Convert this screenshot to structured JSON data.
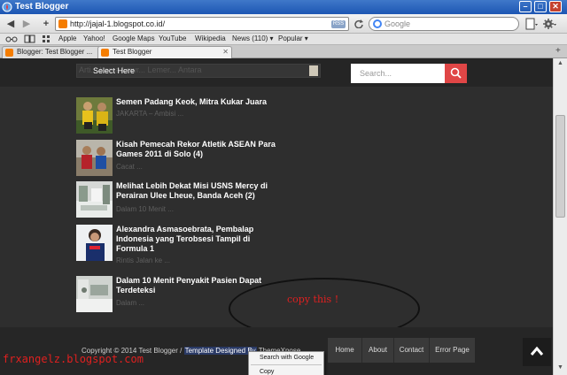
{
  "window": {
    "title": "Test Blogger",
    "minimize_glyph": "–",
    "maximize_glyph": "□",
    "close_glyph": "✕"
  },
  "toolbar": {
    "back_glyph": "◀",
    "forward_glyph": "▶",
    "add_glyph": "+",
    "url": "http://jajal-1.blogspot.co.id/",
    "rss_label": "RSS",
    "search_placeholder": "Google"
  },
  "bookmarks": {
    "reader_icon": "glasses-icon",
    "book_icon": "book-icon",
    "grid_icon": "grid-icon",
    "items": [
      "Apple",
      "Yahoo!",
      "Google Maps",
      "YouTube",
      "Wikipedia",
      "News (110) ▾",
      "Popular ▾"
    ]
  },
  "tabs": [
    {
      "label": "Blogger: Test Blogger ...",
      "close": "✕"
    },
    {
      "label": "Test Blogger",
      "close": "✕"
    }
  ],
  "page": {
    "select": {
      "ghost_text": "Arti... Lama   Lowr...   Lemer...   Antara",
      "label": "Select Here"
    },
    "search_placeholder": "Search...",
    "posts": [
      {
        "title": "Semen Padang Keok, Mitra Kukar Juara",
        "snippet": "JAKARTA – Ambisi ..."
      },
      {
        "title": "Kisah Pemecah Rekor Atletik ASEAN Para Games 2011 di Solo (4)",
        "snippet": "Cacat ..."
      },
      {
        "title": "Melihat Lebih Dekat Misi USNS Mercy di Perairan Ulee Lheue, Banda Aceh (2)",
        "snippet": "Dalam 10 Menit ..."
      },
      {
        "title": "Alexandra Asmasoebrata, Pembalap Indonesia yang Terobsesi Tampil di Formula 1",
        "snippet": "Rintis Jalan ke ..."
      },
      {
        "title": "Dalam 10 Menit Penyakit Pasien Dapat Terdeteksi",
        "snippet": "Dalam ..."
      }
    ],
    "annotation": "copy this !",
    "footer": {
      "copyright": "Copyright © 2014 Test Blogger /",
      "designed_by": "Template Designed By",
      "designer": "ThemeXpose",
      "nav": [
        "Home",
        "About",
        "Contact",
        "Error Page"
      ]
    }
  },
  "watermark": "frxangelz.blogspot.com",
  "context_menu": {
    "items": [
      "Search with Google",
      "Copy"
    ]
  },
  "colors": {
    "page_bg": "#2e2e2e",
    "accent_red": "#e04646",
    "annotation": "#e02020"
  }
}
